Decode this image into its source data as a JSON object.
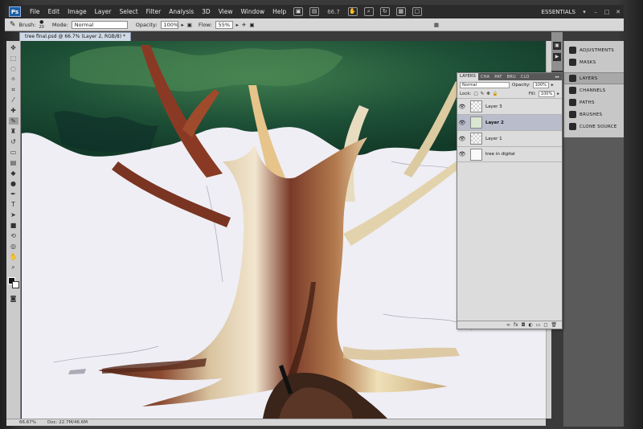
{
  "menubar": {
    "logo": "Ps",
    "items": [
      "File",
      "Edit",
      "Image",
      "Layer",
      "Select",
      "Filter",
      "Analysis",
      "3D",
      "View",
      "Window",
      "Help"
    ],
    "zoom": "66.7",
    "workspace": "ESSENTIALS",
    "win_controls": [
      "–",
      "□",
      "✕"
    ]
  },
  "options": {
    "brush_label": "Brush:",
    "brush_size": "20",
    "mode_label": "Mode:",
    "mode_value": "Normal",
    "opacity_label": "Opacity:",
    "opacity_value": "100%",
    "flow_label": "Flow:",
    "flow_value": "55%"
  },
  "document": {
    "tab_title": "tree final.psd @ 66.7% (Layer 2, RGB/8) *",
    "zoom_status": "66.67%",
    "doc_size": "Doc: 22.7M/46.6M"
  },
  "dock": {
    "items": [
      {
        "label": "ADJUSTMENTS",
        "icon": "adjustments-icon"
      },
      {
        "label": "MASKS",
        "icon": "masks-icon"
      },
      {
        "label": "LAYERS",
        "icon": "layers-icon"
      },
      {
        "label": "CHANNELS",
        "icon": "channels-icon"
      },
      {
        "label": "PATHS",
        "icon": "paths-icon"
      },
      {
        "label": "BRUSHES",
        "icon": "brushes-icon"
      },
      {
        "label": "CLONE SOURCE",
        "icon": "clone-source-icon"
      }
    ]
  },
  "layers_panel": {
    "tabs": [
      "LAYERS",
      "CHA",
      "PAT",
      "BRU",
      "CLO"
    ],
    "menu": "▸▸",
    "blend_mode": "Normal",
    "opacity_label": "Opacity:",
    "opacity_value": "100%",
    "lock_label": "Lock:",
    "fill_label": "Fill:",
    "fill_value": "100%",
    "layers": [
      {
        "name": "Layer 3",
        "thumb": "transparent",
        "selected": false
      },
      {
        "name": "Layer 2",
        "thumb": "tree",
        "selected": true
      },
      {
        "name": "Layer 1",
        "thumb": "transparent",
        "selected": false
      },
      {
        "name": "tree in digital",
        "thumb": "white",
        "selected": false
      }
    ],
    "bottom_icons": [
      "∞",
      "fx",
      "◘",
      "◐",
      "▭",
      "◻",
      "🗑"
    ]
  },
  "colors": {
    "foreground": "#141414",
    "background": "#ffffff",
    "canvas": "#efeef5",
    "foliage": "#1f5a3c",
    "bark_dark": "#6b3524",
    "bark_light": "#e8d8b4"
  }
}
